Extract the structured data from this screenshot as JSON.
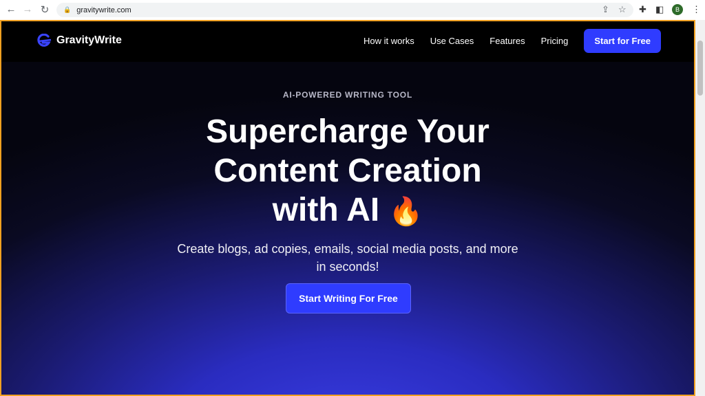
{
  "browser": {
    "url": "gravitywrite.com",
    "avatar_letter": "B"
  },
  "nav": {
    "brand": "GravityWrite",
    "links": [
      "How it works",
      "Use Cases",
      "Features",
      "Pricing"
    ],
    "cta": "Start for Free"
  },
  "hero": {
    "eyebrow": "AI-POWERED WRITING TOOL",
    "title_line1": "Supercharge Your",
    "title_line2": "Content Creation",
    "title_line3": "with AI",
    "emoji": "🔥",
    "subtitle": "Create blogs, ad copies, emails, social media posts, and more in seconds!",
    "cta": "Start Writing For Free"
  },
  "colors": {
    "accent": "#2f3cff",
    "frame": "#f0a020"
  }
}
